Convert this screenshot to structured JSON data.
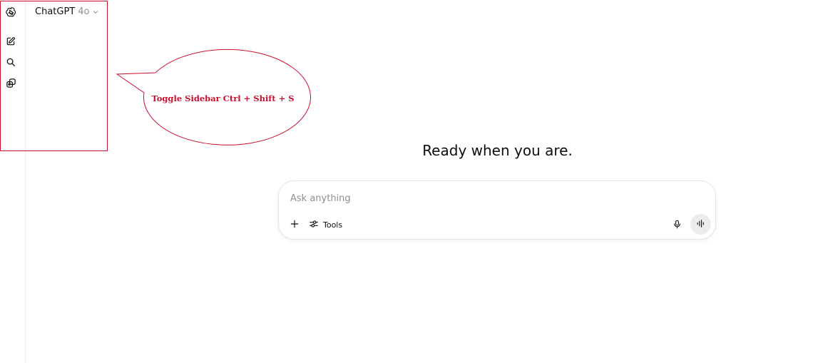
{
  "header": {
    "model_name": "ChatGPT",
    "model_version": "4o"
  },
  "sidebar": {
    "icons": [
      "openai-logo-icon",
      "new-chat-icon",
      "search-icon",
      "library-icon"
    ]
  },
  "annotation": {
    "callout_text": "Toggle Sidebar Ctrl + Shift + S",
    "color": "#c8102e"
  },
  "main": {
    "heading": "Ready when you are."
  },
  "composer": {
    "placeholder": "Ask anything",
    "tools_label": "Tools"
  }
}
